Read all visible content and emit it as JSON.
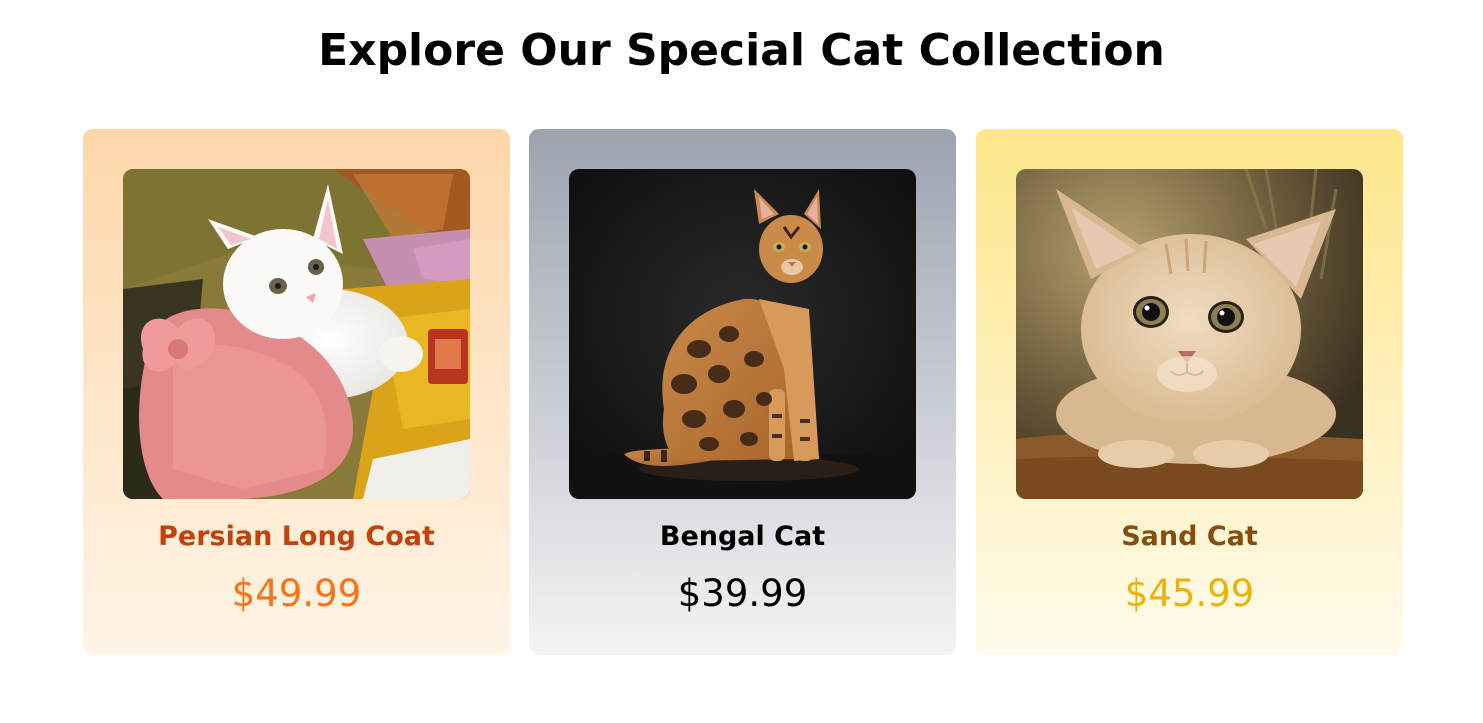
{
  "header": {
    "title": "Explore Our Special Cat Collection"
  },
  "cards": [
    {
      "name": "Persian Long Coat",
      "price": "$49.99",
      "image_icon": "persian-cat-photo",
      "colors": {
        "gradient_top": "#fed7aa",
        "gradient_bottom": "#fff4e6",
        "name": "#c2410c",
        "price": "#f97316"
      }
    },
    {
      "name": "Bengal Cat",
      "price": "$39.99",
      "image_icon": "bengal-cat-photo",
      "colors": {
        "gradient_top": "#9ca3af",
        "gradient_bottom": "#f3f4f6",
        "name": "#000000",
        "price": "#000000"
      }
    },
    {
      "name": "Sand Cat",
      "price": "$45.99",
      "image_icon": "sand-cat-photo",
      "colors": {
        "gradient_top": "#fde68a",
        "gradient_bottom": "#fffbeb",
        "name": "#854d0e",
        "price": "#eab308"
      }
    }
  ]
}
